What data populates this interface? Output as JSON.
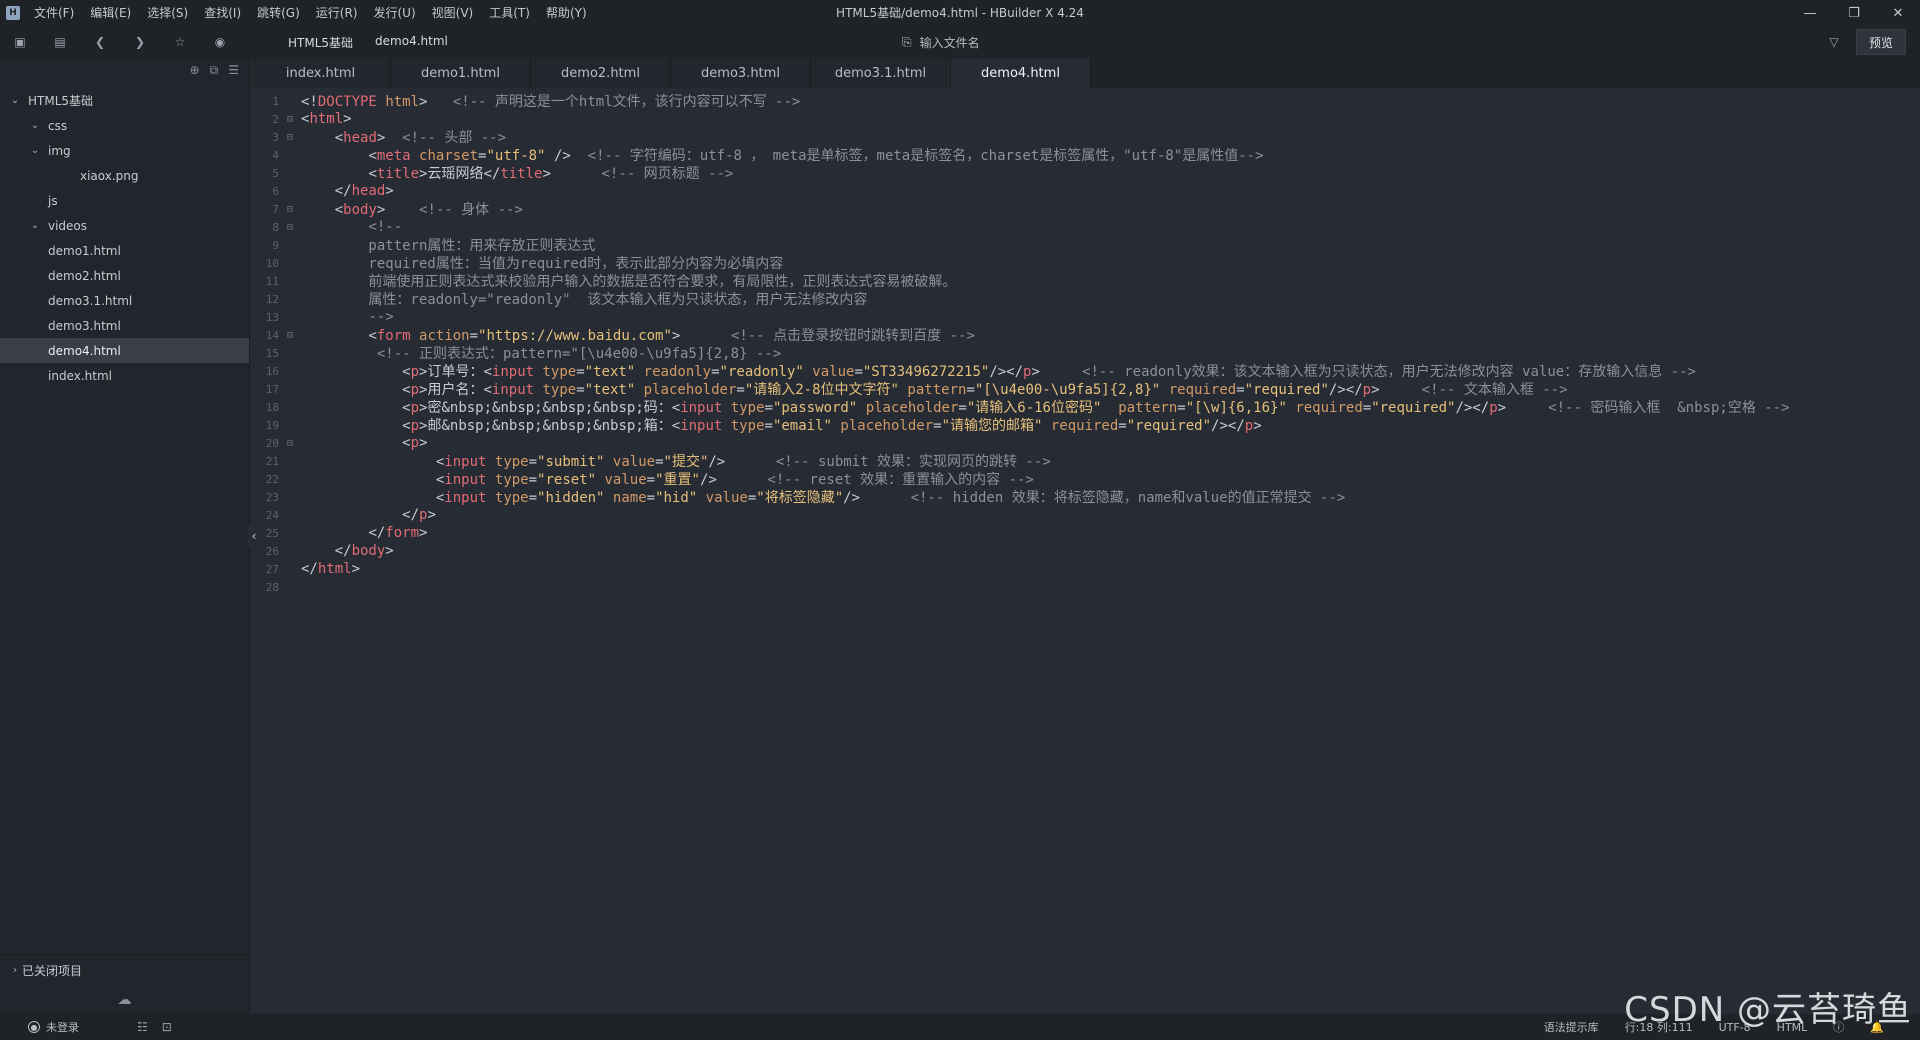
{
  "window": {
    "title": "HTML5基础/demo4.html - HBuilder X 4.24",
    "menu": [
      "文件(F)",
      "编辑(E)",
      "选择(S)",
      "查找(I)",
      "跳转(G)",
      "运行(R)",
      "发行(U)",
      "视图(V)",
      "工具(T)",
      "帮助(Y)"
    ]
  },
  "toolbar": {
    "breadcrumb": [
      "HTML5基础",
      "demo4.html"
    ],
    "search_placeholder": "输入文件名",
    "preview_label": "预览"
  },
  "sidebar": {
    "tree": [
      {
        "label": "HTML5基础",
        "depth": 0,
        "chevron": "open",
        "selected": false
      },
      {
        "label": "css",
        "depth": 1,
        "chevron": "open",
        "selected": false
      },
      {
        "label": "img",
        "depth": 1,
        "chevron": "open",
        "selected": false
      },
      {
        "label": "xiaox.png",
        "depth": 2,
        "chevron": "",
        "selected": false
      },
      {
        "label": "js",
        "depth": 1,
        "chevron": "",
        "selected": false
      },
      {
        "label": "videos",
        "depth": 1,
        "chevron": "open",
        "selected": false
      },
      {
        "label": "demo1.html",
        "depth": 1,
        "chevron": "",
        "selected": false
      },
      {
        "label": "demo2.html",
        "depth": 1,
        "chevron": "",
        "selected": false
      },
      {
        "label": "demo3.1.html",
        "depth": 1,
        "chevron": "",
        "selected": false
      },
      {
        "label": "demo3.html",
        "depth": 1,
        "chevron": "",
        "selected": false
      },
      {
        "label": "demo4.html",
        "depth": 1,
        "chevron": "",
        "selected": true
      },
      {
        "label": "index.html",
        "depth": 1,
        "chevron": "",
        "selected": false
      }
    ],
    "closed_projects_label": "已关闭项目"
  },
  "tabs": [
    {
      "label": "index.html",
      "active": false
    },
    {
      "label": "demo1.html",
      "active": false
    },
    {
      "label": "demo2.html",
      "active": false
    },
    {
      "label": "demo3.html",
      "active": false
    },
    {
      "label": "demo3.1.html",
      "active": false
    },
    {
      "label": "demo4.html",
      "active": true
    }
  ],
  "code_lines": [
    {
      "n": "1",
      "fold": "",
      "tokens": [
        [
          "ang",
          "<!"
        ],
        [
          "kw",
          "DOCTYPE"
        ],
        [
          "txt",
          " "
        ],
        [
          "attr",
          "html"
        ],
        [
          "ang",
          ">"
        ],
        [
          "txt",
          "   "
        ],
        [
          "cmt",
          "<!-- 声明这是一个html文件，该行内容可以不写 -->"
        ]
      ]
    },
    {
      "n": "2",
      "fold": "⊟",
      "tokens": [
        [
          "ang",
          "<"
        ],
        [
          "kw",
          "html"
        ],
        [
          "ang",
          ">"
        ]
      ]
    },
    {
      "n": "3",
      "fold": "⊟",
      "tokens": [
        [
          "txt",
          "    "
        ],
        [
          "ang",
          "<"
        ],
        [
          "kw",
          "head"
        ],
        [
          "ang",
          ">"
        ],
        [
          "txt",
          "  "
        ],
        [
          "cmt",
          "<!-- 头部 -->"
        ]
      ]
    },
    {
      "n": "4",
      "fold": "",
      "tokens": [
        [
          "txt",
          "        "
        ],
        [
          "ang",
          "<"
        ],
        [
          "kw",
          "meta"
        ],
        [
          "txt",
          " "
        ],
        [
          "attr",
          "charset"
        ],
        [
          "ang",
          "="
        ],
        [
          "str",
          "\"utf-8\""
        ],
        [
          "txt",
          " "
        ],
        [
          "ang",
          "/>"
        ],
        [
          "txt",
          "  "
        ],
        [
          "cmt",
          "<!-- 字符编码：utf-8 ， meta是单标签，meta是标签名，charset是标签属性，\"utf-8\"是属性值-->"
        ]
      ]
    },
    {
      "n": "5",
      "fold": "",
      "tokens": [
        [
          "txt",
          "        "
        ],
        [
          "ang",
          "<"
        ],
        [
          "kw",
          "title"
        ],
        [
          "ang",
          ">"
        ],
        [
          "txt",
          "云瑶网络"
        ],
        [
          "ang",
          "</"
        ],
        [
          "kw",
          "title"
        ],
        [
          "ang",
          ">"
        ],
        [
          "txt",
          "      "
        ],
        [
          "cmt",
          "<!-- 网页标题 -->"
        ]
      ]
    },
    {
      "n": "6",
      "fold": "",
      "tokens": [
        [
          "txt",
          "    "
        ],
        [
          "ang",
          "</"
        ],
        [
          "kw",
          "head"
        ],
        [
          "ang",
          ">"
        ]
      ]
    },
    {
      "n": "7",
      "fold": "⊟",
      "tokens": [
        [
          "txt",
          "    "
        ],
        [
          "ang",
          "<"
        ],
        [
          "kw",
          "body"
        ],
        [
          "ang",
          ">"
        ],
        [
          "txt",
          "    "
        ],
        [
          "cmt",
          "<!-- 身体 -->"
        ]
      ]
    },
    {
      "n": "8",
      "fold": "⊟",
      "tokens": [
        [
          "txt",
          "        "
        ],
        [
          "cmt",
          "<!--"
        ]
      ]
    },
    {
      "n": "9",
      "fold": "",
      "tokens": [
        [
          "cmt",
          "        pattern属性：用来存放正则表达式"
        ]
      ]
    },
    {
      "n": "10",
      "fold": "",
      "tokens": [
        [
          "cmt",
          "        required属性：当值为required时，表示此部分内容为必填内容"
        ]
      ]
    },
    {
      "n": "11",
      "fold": "",
      "tokens": [
        [
          "cmt",
          "        前端使用正则表达式来校验用户输入的数据是否符合要求，有局限性，正则表达式容易被破解。"
        ]
      ]
    },
    {
      "n": "12",
      "fold": "",
      "tokens": [
        [
          "cmt",
          "        属性：readonly=\"readonly\"  该文本输入框为只读状态，用户无法修改内容"
        ]
      ]
    },
    {
      "n": "13",
      "fold": "",
      "tokens": [
        [
          "cmt",
          "        -->"
        ]
      ]
    },
    {
      "n": "14",
      "fold": "⊟",
      "tokens": [
        [
          "txt",
          "        "
        ],
        [
          "ang",
          "<"
        ],
        [
          "kw",
          "form"
        ],
        [
          "txt",
          " "
        ],
        [
          "attr",
          "action"
        ],
        [
          "ang",
          "="
        ],
        [
          "str",
          "\"https://www.baidu.com\""
        ],
        [
          "ang",
          ">"
        ],
        [
          "txt",
          "      "
        ],
        [
          "cmt",
          "<!-- 点击登录按钮时跳转到百度 -->"
        ]
      ]
    },
    {
      "n": "15",
      "fold": "",
      "tokens": [
        [
          "txt",
          "         "
        ],
        [
          "cmt",
          "<!-- 正则表达式：pattern=\"[\\u4e00-\\u9fa5]{2,8} -->"
        ]
      ]
    },
    {
      "n": "16",
      "fold": "",
      "tokens": [
        [
          "txt",
          "            "
        ],
        [
          "ang",
          "<"
        ],
        [
          "kw",
          "p"
        ],
        [
          "ang",
          ">"
        ],
        [
          "txt",
          "订单号："
        ],
        [
          "ang",
          "<"
        ],
        [
          "kw",
          "input"
        ],
        [
          "txt",
          " "
        ],
        [
          "attr",
          "type"
        ],
        [
          "ang",
          "="
        ],
        [
          "str",
          "\"text\""
        ],
        [
          "txt",
          " "
        ],
        [
          "attr",
          "readonly"
        ],
        [
          "ang",
          "="
        ],
        [
          "str",
          "\"readonly\""
        ],
        [
          "txt",
          " "
        ],
        [
          "attr",
          "value"
        ],
        [
          "ang",
          "="
        ],
        [
          "str",
          "\"ST33496272215\""
        ],
        [
          "ang",
          "/></"
        ],
        [
          "kw",
          "p"
        ],
        [
          "ang",
          ">"
        ],
        [
          "txt",
          "     "
        ],
        [
          "cmt",
          "<!-- readonly效果：该文本输入框为只读状态，用户无法修改内容 value：存放输入信息 -->"
        ]
      ]
    },
    {
      "n": "17",
      "fold": "",
      "tokens": [
        [
          "txt",
          "            "
        ],
        [
          "ang",
          "<"
        ],
        [
          "kw",
          "p"
        ],
        [
          "ang",
          ">"
        ],
        [
          "txt",
          "用户名："
        ],
        [
          "ang",
          "<"
        ],
        [
          "kw",
          "input"
        ],
        [
          "txt",
          " "
        ],
        [
          "attr",
          "type"
        ],
        [
          "ang",
          "="
        ],
        [
          "str",
          "\"text\""
        ],
        [
          "txt",
          " "
        ],
        [
          "attr",
          "placeholder"
        ],
        [
          "ang",
          "="
        ],
        [
          "str",
          "\"请输入2-8位中文字符\""
        ],
        [
          "txt",
          " "
        ],
        [
          "attr",
          "pattern"
        ],
        [
          "ang",
          "="
        ],
        [
          "str",
          "\"[\\u4e00-\\u9fa5]{2,8}\""
        ],
        [
          "txt",
          " "
        ],
        [
          "attr",
          "required"
        ],
        [
          "ang",
          "="
        ],
        [
          "str",
          "\"required\""
        ],
        [
          "ang",
          "/></"
        ],
        [
          "kw",
          "p"
        ],
        [
          "ang",
          ">"
        ],
        [
          "txt",
          "     "
        ],
        [
          "cmt",
          "<!-- 文本输入框 -->"
        ]
      ]
    },
    {
      "n": "18",
      "fold": "",
      "tokens": [
        [
          "txt",
          "            "
        ],
        [
          "ang",
          "<"
        ],
        [
          "kw",
          "p"
        ],
        [
          "ang",
          ">"
        ],
        [
          "txt",
          "密&nbsp;&nbsp;&nbsp;&nbsp;码："
        ],
        [
          "ang",
          "<"
        ],
        [
          "kw",
          "input"
        ],
        [
          "txt",
          " "
        ],
        [
          "attr",
          "type"
        ],
        [
          "ang",
          "="
        ],
        [
          "str",
          "\"password\""
        ],
        [
          "txt",
          " "
        ],
        [
          "attr",
          "placeholder"
        ],
        [
          "ang",
          "="
        ],
        [
          "str",
          "\"请输入6-16位密码\""
        ],
        [
          "txt",
          "  "
        ],
        [
          "attr",
          "pattern"
        ],
        [
          "ang",
          "="
        ],
        [
          "str",
          "\"[\\w]{6,16}\""
        ],
        [
          "txt",
          " "
        ],
        [
          "attr",
          "required"
        ],
        [
          "ang",
          "="
        ],
        [
          "str",
          "\"required\""
        ],
        [
          "ang",
          "/></"
        ],
        [
          "kw",
          "p"
        ],
        [
          "ang",
          ">"
        ],
        [
          "txt",
          "     "
        ],
        [
          "cmt",
          "<!-- 密码输入框  &nbsp;空格 -->"
        ]
      ]
    },
    {
      "n": "19",
      "fold": "",
      "tokens": [
        [
          "txt",
          "            "
        ],
        [
          "ang",
          "<"
        ],
        [
          "kw",
          "p"
        ],
        [
          "ang",
          ">"
        ],
        [
          "txt",
          "邮&nbsp;&nbsp;&nbsp;&nbsp;箱："
        ],
        [
          "ang",
          "<"
        ],
        [
          "kw",
          "input"
        ],
        [
          "txt",
          " "
        ],
        [
          "attr",
          "type"
        ],
        [
          "ang",
          "="
        ],
        [
          "str",
          "\"email\""
        ],
        [
          "txt",
          " "
        ],
        [
          "attr",
          "placeholder"
        ],
        [
          "ang",
          "="
        ],
        [
          "str",
          "\"请输您的邮箱\""
        ],
        [
          "txt",
          " "
        ],
        [
          "attr",
          "required"
        ],
        [
          "ang",
          "="
        ],
        [
          "str",
          "\"required\""
        ],
        [
          "ang",
          "/></"
        ],
        [
          "kw",
          "p"
        ],
        [
          "ang",
          ">"
        ]
      ]
    },
    {
      "n": "20",
      "fold": "⊟",
      "tokens": [
        [
          "txt",
          "            "
        ],
        [
          "ang",
          "<"
        ],
        [
          "kw",
          "p"
        ],
        [
          "ang",
          ">"
        ]
      ]
    },
    {
      "n": "21",
      "fold": "",
      "tokens": [
        [
          "txt",
          "                "
        ],
        [
          "ang",
          "<"
        ],
        [
          "kw",
          "input"
        ],
        [
          "txt",
          " "
        ],
        [
          "attr",
          "type"
        ],
        [
          "ang",
          "="
        ],
        [
          "str",
          "\"submit\""
        ],
        [
          "txt",
          " "
        ],
        [
          "attr",
          "value"
        ],
        [
          "ang",
          "="
        ],
        [
          "str",
          "\"提交\""
        ],
        [
          "ang",
          "/>"
        ],
        [
          "txt",
          "      "
        ],
        [
          "cmt",
          "<!-- submit 效果：实现网页的跳转 -->"
        ]
      ]
    },
    {
      "n": "22",
      "fold": "",
      "tokens": [
        [
          "txt",
          "                "
        ],
        [
          "ang",
          "<"
        ],
        [
          "kw",
          "input"
        ],
        [
          "txt",
          " "
        ],
        [
          "attr",
          "type"
        ],
        [
          "ang",
          "="
        ],
        [
          "str",
          "\"reset\""
        ],
        [
          "txt",
          " "
        ],
        [
          "attr",
          "value"
        ],
        [
          "ang",
          "="
        ],
        [
          "str",
          "\"重置\""
        ],
        [
          "ang",
          "/>"
        ],
        [
          "txt",
          "      "
        ],
        [
          "cmt",
          "<!-- reset 效果：重置输入的内容 -->"
        ]
      ]
    },
    {
      "n": "23",
      "fold": "",
      "tokens": [
        [
          "txt",
          "                "
        ],
        [
          "ang",
          "<"
        ],
        [
          "kw",
          "input"
        ],
        [
          "txt",
          " "
        ],
        [
          "attr",
          "type"
        ],
        [
          "ang",
          "="
        ],
        [
          "str",
          "\"hidden\""
        ],
        [
          "txt",
          " "
        ],
        [
          "attr",
          "name"
        ],
        [
          "ang",
          "="
        ],
        [
          "str",
          "\"hid\""
        ],
        [
          "txt",
          " "
        ],
        [
          "attr",
          "value"
        ],
        [
          "ang",
          "="
        ],
        [
          "str",
          "\"将标签隐藏\""
        ],
        [
          "ang",
          "/>"
        ],
        [
          "txt",
          "      "
        ],
        [
          "cmt",
          "<!-- hidden 效果：将标签隐藏，name和value的值正常提交 -->"
        ]
      ]
    },
    {
      "n": "24",
      "fold": "",
      "tokens": [
        [
          "txt",
          "            "
        ],
        [
          "ang",
          "</"
        ],
        [
          "kw",
          "p"
        ],
        [
          "ang",
          ">"
        ]
      ]
    },
    {
      "n": "25",
      "fold": "",
      "tokens": [
        [
          "txt",
          "        "
        ],
        [
          "ang",
          "</"
        ],
        [
          "kw",
          "form"
        ],
        [
          "ang",
          ">"
        ]
      ]
    },
    {
      "n": "26",
      "fold": "",
      "tokens": [
        [
          "txt",
          "    "
        ],
        [
          "ang",
          "</"
        ],
        [
          "kw",
          "body"
        ],
        [
          "ang",
          ">"
        ]
      ]
    },
    {
      "n": "27",
      "fold": "",
      "tokens": [
        [
          "ang",
          "</"
        ],
        [
          "kw",
          "html"
        ],
        [
          "ang",
          ">"
        ]
      ]
    },
    {
      "n": "28",
      "fold": "",
      "tokens": []
    }
  ],
  "statusbar": {
    "user_label": "未登录",
    "syntax_hint": "语法提示库",
    "cursor": "行:18  列:111",
    "encoding": "UTF-8",
    "language": "HTML"
  },
  "watermark": "CSDN @云苔琦鱼"
}
